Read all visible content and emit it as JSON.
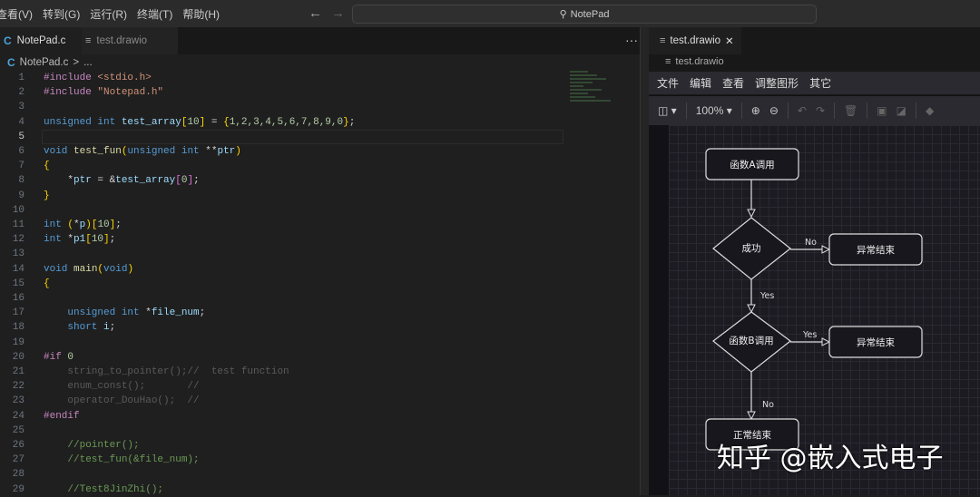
{
  "menubar": {
    "items": [
      "查看(V)",
      "转到(G)",
      "运行(R)",
      "终端(T)",
      "帮助(H)"
    ]
  },
  "nav": {
    "back": "←",
    "forward": "→"
  },
  "command_center": {
    "icon": "search-icon",
    "text": "NotePad"
  },
  "editor_tabs": [
    {
      "label": "NotePad.c",
      "icon": "C",
      "modified": true
    },
    {
      "label": "test.drawio"
    }
  ],
  "more": "···",
  "breadcrumb": {
    "icon": "C",
    "file": "NotePad.c",
    "sep": ">",
    "rest": "..."
  },
  "current_line": 5,
  "code": [
    [
      [
        "pp",
        "#include "
      ],
      [
        "str",
        "<stdio.h>"
      ]
    ],
    [
      [
        "pp",
        "#include "
      ],
      [
        "str",
        "\"Notepad.h\""
      ]
    ],
    [],
    [
      [
        "kw",
        "unsigned int "
      ],
      [
        "var",
        "test_array"
      ],
      [
        "br",
        "["
      ],
      [
        "num",
        "10"
      ],
      [
        "br",
        "]"
      ],
      [
        "pl",
        " = "
      ],
      [
        "br",
        "{"
      ],
      [
        "num",
        "1,2,3,4,5,6,7,8,9,0"
      ],
      [
        "br",
        "}"
      ],
      [
        "pl",
        ";"
      ]
    ],
    [],
    [
      [
        "kw",
        "void "
      ],
      [
        "fn",
        "test_fun"
      ],
      [
        "br",
        "("
      ],
      [
        "kw",
        "unsigned int "
      ],
      [
        "pl",
        "**"
      ],
      [
        "var",
        "ptr"
      ],
      [
        "br",
        ")"
      ]
    ],
    [
      [
        "br",
        "{"
      ]
    ],
    [
      [
        "pl",
        "    *"
      ],
      [
        "var",
        "ptr"
      ],
      [
        "pl",
        " = &"
      ],
      [
        "var",
        "test_array"
      ],
      [
        "br2",
        "["
      ],
      [
        "num",
        "0"
      ],
      [
        "br2",
        "]"
      ],
      [
        "pl",
        ";"
      ]
    ],
    [
      [
        "br",
        "}"
      ]
    ],
    [],
    [
      [
        "kw",
        "int "
      ],
      [
        "br",
        "("
      ],
      [
        "pl",
        "*"
      ],
      [
        "var",
        "p"
      ],
      [
        "br",
        ")"
      ],
      [
        "br",
        "["
      ],
      [
        "num",
        "10"
      ],
      [
        "br",
        "]"
      ],
      [
        "pl",
        ";"
      ]
    ],
    [
      [
        "kw",
        "int "
      ],
      [
        "pl",
        "*"
      ],
      [
        "var",
        "p1"
      ],
      [
        "br",
        "["
      ],
      [
        "num",
        "10"
      ],
      [
        "br",
        "]"
      ],
      [
        "pl",
        ";"
      ]
    ],
    [],
    [
      [
        "kw",
        "void "
      ],
      [
        "fn",
        "main"
      ],
      [
        "br",
        "("
      ],
      [
        "kw",
        "void"
      ],
      [
        "br",
        ")"
      ]
    ],
    [
      [
        "br",
        "{"
      ]
    ],
    [],
    [
      [
        "kw",
        "    unsigned int "
      ],
      [
        "pl",
        "*"
      ],
      [
        "var",
        "file_num"
      ],
      [
        "pl",
        ";"
      ]
    ],
    [
      [
        "kw",
        "    short "
      ],
      [
        "var",
        "i"
      ],
      [
        "pl",
        ";"
      ]
    ],
    [],
    [
      [
        "pp",
        "#if "
      ],
      [
        "num",
        "0"
      ]
    ],
    [
      [
        "dim",
        "    string_to_pointer();//  test function"
      ]
    ],
    [
      [
        "dim",
        "    enum_const();       //"
      ]
    ],
    [
      [
        "dim",
        "    operator_DouHao();  //"
      ]
    ],
    [
      [
        "pp",
        "#endif"
      ]
    ],
    [],
    [
      [
        "cm",
        "    //pointer();"
      ]
    ],
    [
      [
        "cm",
        "    //test_fun(&file_num);"
      ]
    ],
    [],
    [
      [
        "cm",
        "    //Test8JinZhi();"
      ]
    ]
  ],
  "right_panel": {
    "tab": {
      "label": "test.drawio",
      "close": "✕"
    },
    "breadcrumb": "test.drawio",
    "menu": [
      "文件",
      "编辑",
      "查看",
      "调整图形",
      "其它"
    ],
    "toolbar": {
      "zoom": "100%"
    }
  },
  "diagram": {
    "start": "函数A调用",
    "decision1": "成功",
    "error1": "异常结束",
    "decision2": "函数B调用",
    "error2": "异常结束",
    "end": "正常结束",
    "labels": {
      "d1_no": "No",
      "d1_yes": "Yes",
      "d2_yes": "Yes",
      "d2_no": "No"
    }
  },
  "watermark": "知乎 @嵌入式电子"
}
